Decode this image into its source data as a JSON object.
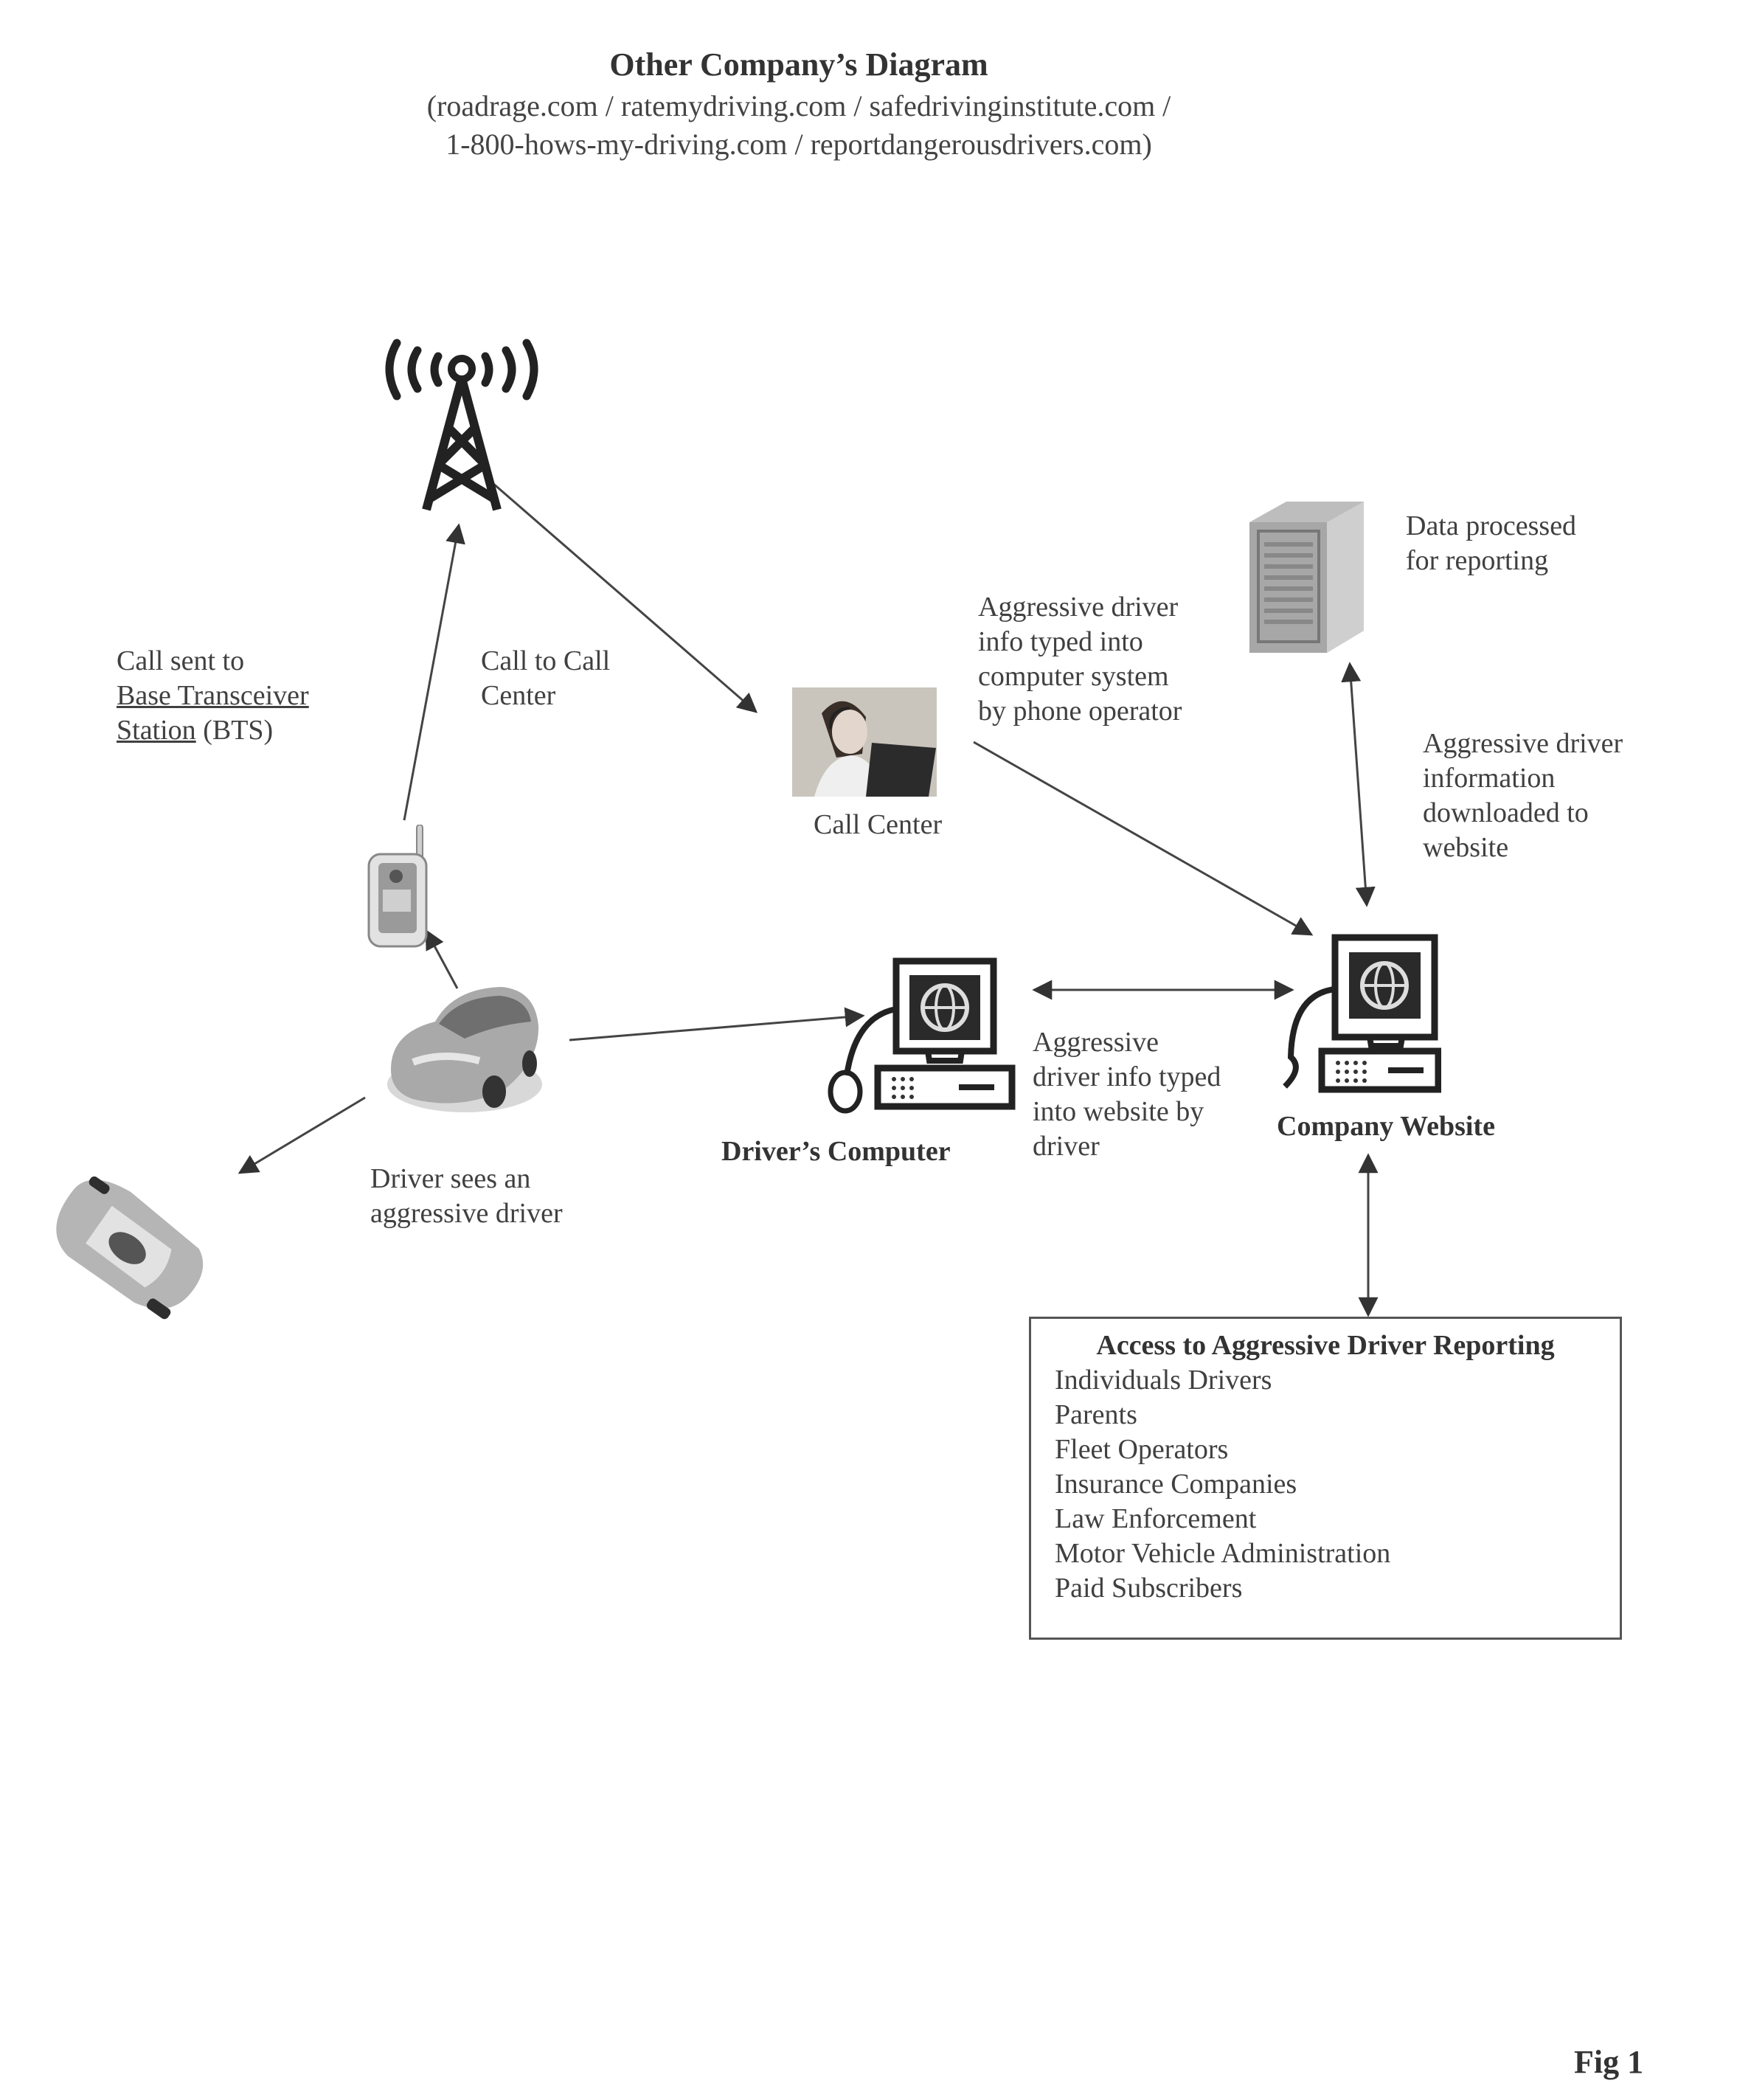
{
  "header": {
    "title": "Other Company’s Diagram",
    "subtitle_line1": "(roadrage.com / ratemydriving.com / safedrivinginstitute.com /",
    "subtitle_line2": "1-800-hows-my-driving.com / reportdangerousdrivers.com)"
  },
  "nodes": {
    "tower": {
      "icon": "cell-tower-icon"
    },
    "phone": {
      "icon": "cell-phone-icon"
    },
    "driver_car": {
      "icon": "car-icon"
    },
    "aggressive_car": {
      "icon": "car-icon"
    },
    "call_center": {
      "icon": "call-center-operator-icon",
      "label": "Call Center"
    },
    "server": {
      "icon": "server-icon"
    },
    "drivers_computer": {
      "icon": "computer-icon",
      "label": "Driver’s Computer"
    },
    "company_website": {
      "icon": "computer-icon",
      "label": "Company Website"
    }
  },
  "labels": {
    "call_sent_line1": "Call sent to",
    "call_sent_line2": "Base Transceiver",
    "call_sent_line3_underlined": "Station",
    "call_sent_line3_rest": " (BTS)",
    "call_to_call_center": [
      "Call to Call",
      "Center"
    ],
    "operator_typed": [
      "Aggressive driver",
      "info typed into",
      "computer system",
      "by phone operator"
    ],
    "data_processed": [
      "Data processed",
      "for reporting"
    ],
    "info_downloaded": [
      "Aggressive driver",
      "information",
      "downloaded to",
      "website"
    ],
    "driver_typed": [
      "Aggressive",
      "driver info typed",
      "into website by",
      "driver"
    ],
    "driver_sees": [
      "Driver sees an",
      "aggressive driver"
    ]
  },
  "access_box": {
    "title": "Access to Aggressive Driver Reporting",
    "items": [
      "Individuals Drivers",
      "Parents",
      "Fleet Operators",
      "Insurance Companies",
      "Law Enforcement",
      "Motor Vehicle Administration",
      "Paid Subscribers"
    ]
  },
  "figure_label": "Fig 1"
}
